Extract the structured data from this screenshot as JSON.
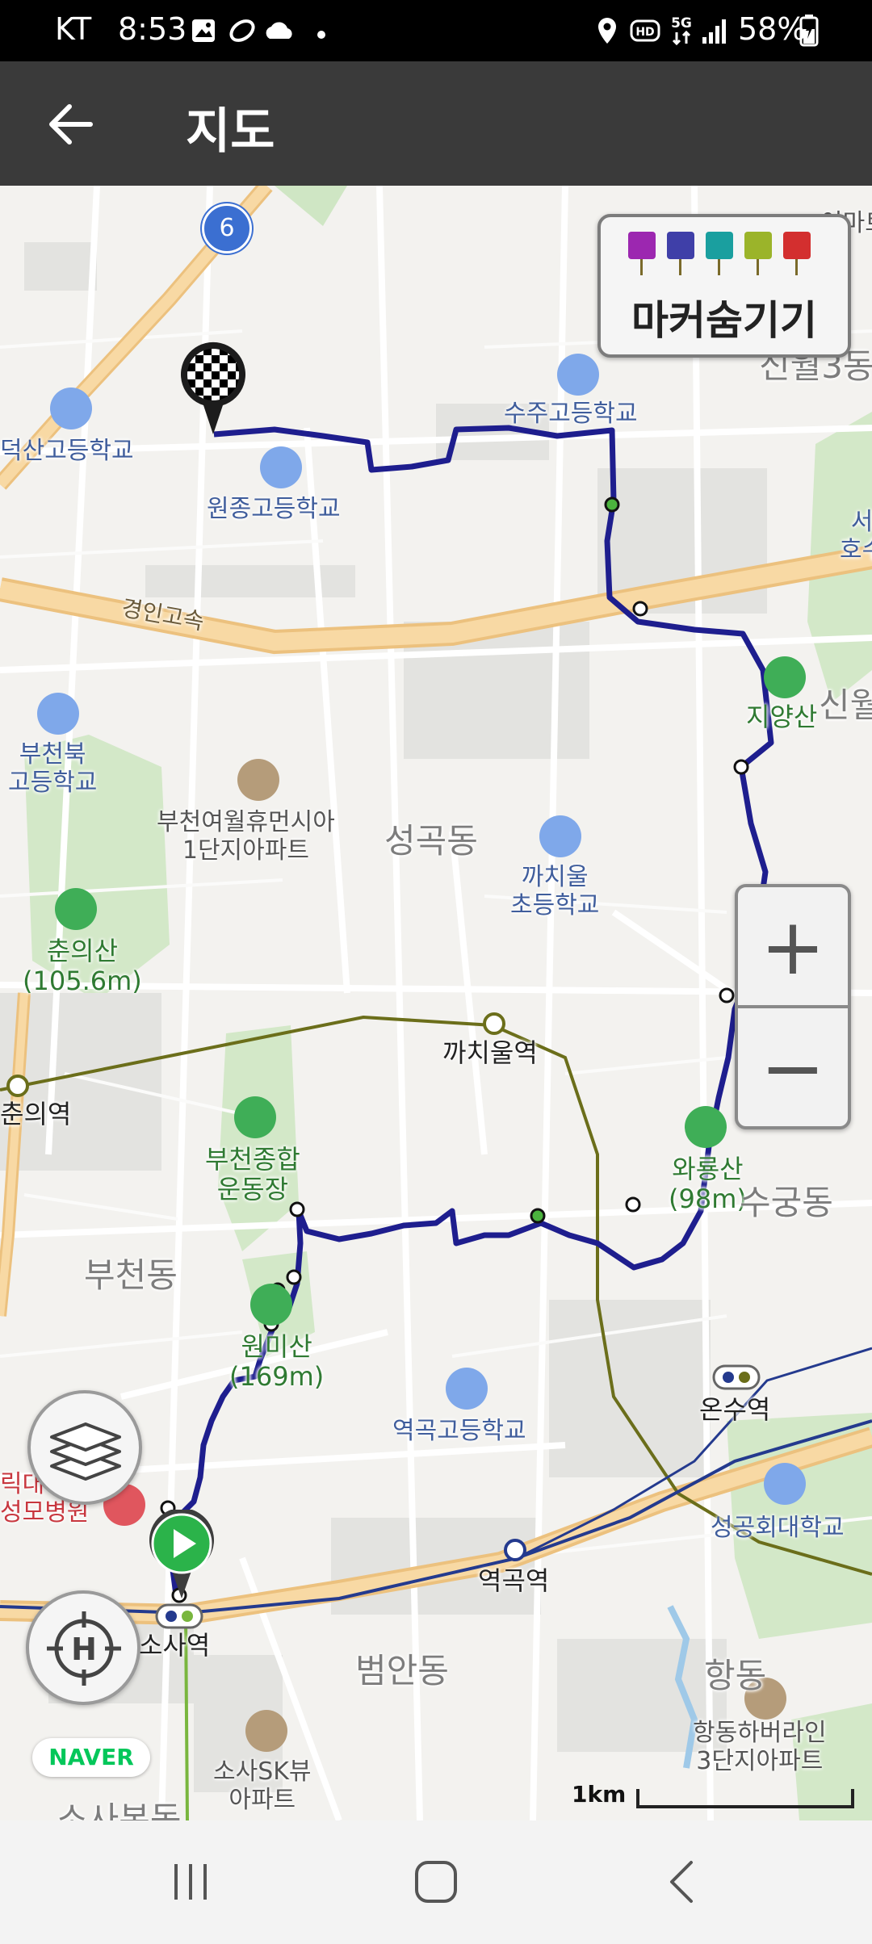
{
  "status_bar": {
    "carrier": "KT",
    "time": "8:53",
    "network": "5G",
    "hd": "HD",
    "battery": "58%"
  },
  "app_bar": {
    "title": "지도"
  },
  "marker_panel": {
    "label": "마커숨기기",
    "pin_icons": [
      "camera-pin-icon",
      "video-pin-icon",
      "voice-pin-icon",
      "memo-pin-icon",
      "flag-pin-icon"
    ],
    "pin_colors": [
      "#9c27b0",
      "#3f3fa8",
      "#1a9f9f",
      "#9bb42a",
      "#d32f2f"
    ]
  },
  "map": {
    "route_color": "#1e1e8e",
    "labels": {
      "road_number": "6",
      "area_top_right": "이마트",
      "sinwol3": "신월3동",
      "deoksan_school": "덕산고등학교",
      "wonjong_school": "원종고등학교",
      "suju_school": "수주고등학교",
      "east_cut": "서\n호수",
      "gyeongin_expressway": "경인고속",
      "jiyang_mountain": "지양산",
      "sinwol_cut": "신월",
      "bucheonbuk_school": "부천북\n고등학교",
      "yeowol_apt": "부천여월휴먼시아\n1단지아파트",
      "seonggok_dong": "성곡동",
      "kkachiul_school": "까치울\n초등학교",
      "chunui_mountain": "춘의산\n(105.6m)",
      "kkachiul_station": "까치울역",
      "chunui_station": "춘의역",
      "stadium": "부천종합\n운동장",
      "waryong_mountain": "와룡산\n(98m)",
      "sugung_dong": "수궁동",
      "bucheon_dong": "부천동",
      "wonmi_mountain": "원미산\n(169m)",
      "yeokgok_school": "역곡고등학교",
      "onsu_station": "온수역",
      "hospital": "릭대학교\n성모병원",
      "sunggonghoe_univ": "성공회대학교",
      "yeokgok_station": "역곡역",
      "sosa_station": "소사역",
      "beoman_dong": "범안동",
      "hangdong_cut": "항동",
      "hangdong_apt": "항동하버라인\n3단지아파트",
      "sosa_sk_apt": "소사SK뷰\n아파트",
      "bottom_cut": "소사본동"
    },
    "naver_logo": "NAVER",
    "scale_label": "1km"
  },
  "zoom": {
    "in_label": "+",
    "out_label": "−"
  }
}
